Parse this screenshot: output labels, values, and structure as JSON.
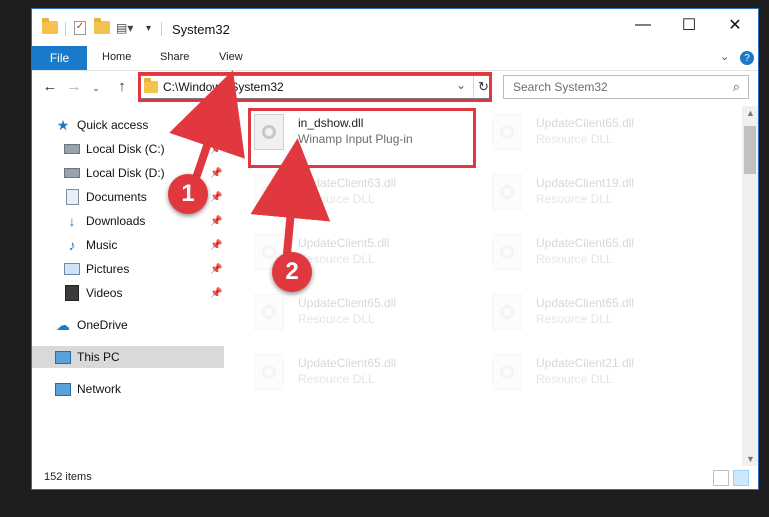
{
  "window": {
    "title": "System32"
  },
  "ribbon": {
    "tabs": [
      "File",
      "Home",
      "Share",
      "View"
    ]
  },
  "nav": {
    "address": "C:\\Windows\\System32",
    "search_placeholder": "Search System32"
  },
  "sidebar": {
    "items": [
      {
        "label": "Quick access",
        "icon": "star-icon"
      },
      {
        "label": "Local Disk (C:)",
        "icon": "drive-icon",
        "pinned": true
      },
      {
        "label": "Local Disk (D:)",
        "icon": "drive-icon",
        "pinned": true
      },
      {
        "label": "Documents",
        "icon": "documents-icon",
        "pinned": true
      },
      {
        "label": "Downloads",
        "icon": "download-icon",
        "pinned": true
      },
      {
        "label": "Music",
        "icon": "music-icon",
        "pinned": true
      },
      {
        "label": "Pictures",
        "icon": "pictures-icon",
        "pinned": true
      },
      {
        "label": "Videos",
        "icon": "videos-icon",
        "pinned": true
      },
      {
        "label": "OneDrive",
        "icon": "cloud-icon"
      },
      {
        "label": "This PC",
        "icon": "computer-icon",
        "selected": true
      },
      {
        "label": "Network",
        "icon": "network-icon"
      }
    ]
  },
  "files": [
    {
      "name": "in_dshow.dll",
      "type": "Winamp Input Plug-in",
      "highlighted": true
    },
    {
      "name": "UpdateClient65.dll",
      "type": "Resource DLL"
    },
    {
      "name": "UpdateClient63.dll",
      "type": "Resource DLL"
    },
    {
      "name": "UpdateClient19.dll",
      "type": "Resource DLL"
    },
    {
      "name": "UpdateClient5.dll",
      "type": "Resource DLL"
    },
    {
      "name": "UpdateClient65.dll",
      "type": "Resource DLL"
    },
    {
      "name": "UpdateClient65.dll",
      "type": "Resource DLL"
    },
    {
      "name": "UpdateClient65.dll",
      "type": "Resource DLL"
    },
    {
      "name": "UpdateClient65.dll",
      "type": "Resource DLL"
    },
    {
      "name": "UpdateClient21.dll",
      "type": "Resource DLL"
    }
  ],
  "status": {
    "item_count": "152 items"
  },
  "annotations": {
    "step1": "1",
    "step2": "2"
  },
  "colors": {
    "accent": "#1979ca",
    "annotation": "#e0383e",
    "selected": "#d9d9d9"
  }
}
